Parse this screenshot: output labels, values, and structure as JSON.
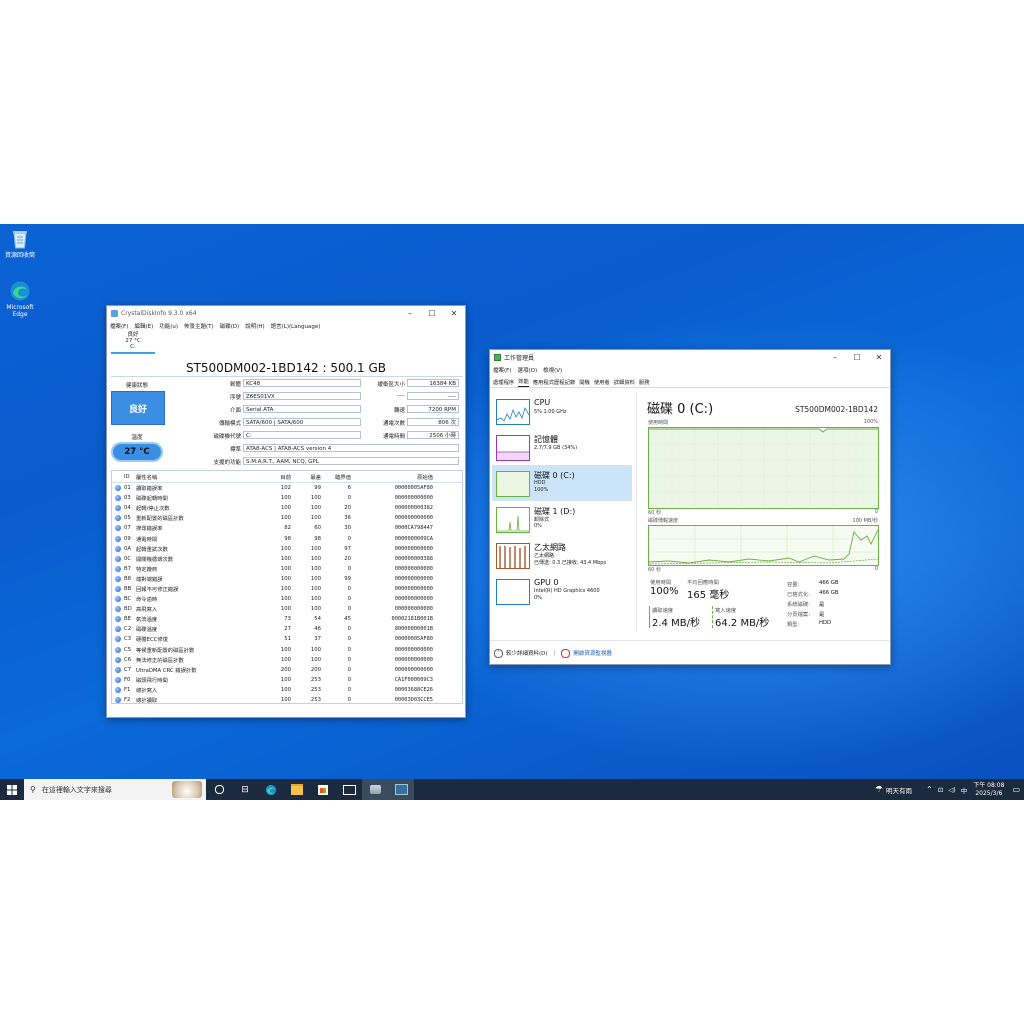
{
  "desktop": {
    "icons": [
      {
        "label": "資源回收筒"
      },
      {
        "label": "Microsoft Edge"
      }
    ]
  },
  "cdi": {
    "title": "CrystalDiskInfo 9.3.0 x64",
    "menu": [
      "檔案(F)",
      "編輯(E)",
      "功能(u)",
      "佈景主題(T)",
      "磁碟(D)",
      "說明(H)",
      "語言(L)(Language)"
    ],
    "status_tab": {
      "health": "良好",
      "temp": "27 °C",
      "drive": "C:"
    },
    "model": "ST500DM002-1BD142 : 500.1 GB",
    "health_label": "健康狀態",
    "health_value": "良好",
    "temp_label": "溫度",
    "temp_value": "27 °C",
    "fields": {
      "firmware": {
        "label": "韌體",
        "value": "KC48"
      },
      "serial": {
        "label": "序號",
        "value": "Z6ES01VX"
      },
      "interface": {
        "label": "介面",
        "value": "Serial ATA"
      },
      "transfer": {
        "label": "傳輸模式",
        "value": "SATA/600 | SATA/600"
      },
      "drive_letter": {
        "label": "磁碟機代號",
        "value": "C:"
      },
      "standard": {
        "label": "標準",
        "value": "ATA8-ACS | ATA8-ACS version 4"
      },
      "features": {
        "label": "支援的功能",
        "value": "S.M.A.R.T., AAM, NCQ, GPL"
      },
      "buffer": {
        "label": "緩衝區大小",
        "value": "16384 KB"
      },
      "blank1": {
        "label": "----",
        "value": "----"
      },
      "rpm": {
        "label": "轉速",
        "value": "7200 RPM"
      },
      "power_count": {
        "label": "通電次數",
        "value": "806 次"
      },
      "power_hours": {
        "label": "通電時間",
        "value": "2506 小時"
      }
    },
    "table_headers": [
      "ID",
      "屬性名稱",
      "目前",
      "最差",
      "臨界值",
      "原始值"
    ],
    "rows": [
      {
        "id": "01",
        "name": "讀取錯誤率",
        "cur": "102",
        "wst": "99",
        "thr": "6",
        "raw": "00000005AF80"
      },
      {
        "id": "03",
        "name": "磁碟起轉時間",
        "cur": "100",
        "wst": "100",
        "thr": "0",
        "raw": "000000000000"
      },
      {
        "id": "04",
        "name": "起轉/停止次數",
        "cur": "100",
        "wst": "100",
        "thr": "20",
        "raw": "000000000382"
      },
      {
        "id": "05",
        "name": "重新配置的磁區計數",
        "cur": "100",
        "wst": "100",
        "thr": "36",
        "raw": "000000000000"
      },
      {
        "id": "07",
        "name": "搜尋錯誤率",
        "cur": "82",
        "wst": "60",
        "thr": "30",
        "raw": "0000CA798447"
      },
      {
        "id": "09",
        "name": "通電時間",
        "cur": "98",
        "wst": "98",
        "thr": "0",
        "raw": "0000000009CA"
      },
      {
        "id": "0A",
        "name": "起轉重試次數",
        "cur": "100",
        "wst": "100",
        "thr": "97",
        "raw": "000000000000"
      },
      {
        "id": "0C",
        "name": "開關機循環次數",
        "cur": "100",
        "wst": "100",
        "thr": "20",
        "raw": "000000000388"
      },
      {
        "id": "B7",
        "name": "特定廠商",
        "cur": "100",
        "wst": "100",
        "thr": "0",
        "raw": "000000000000"
      },
      {
        "id": "B8",
        "name": "端對端錯誤",
        "cur": "100",
        "wst": "100",
        "thr": "99",
        "raw": "000000000000"
      },
      {
        "id": "BB",
        "name": "回報不可修正錯誤",
        "cur": "100",
        "wst": "100",
        "thr": "0",
        "raw": "000000000000"
      },
      {
        "id": "BC",
        "name": "命令逾時",
        "cur": "100",
        "wst": "100",
        "thr": "0",
        "raw": "000000000000"
      },
      {
        "id": "BD",
        "name": "高飛寫入",
        "cur": "100",
        "wst": "100",
        "thr": "0",
        "raw": "000000000000"
      },
      {
        "id": "BE",
        "name": "氣流溫度",
        "cur": "73",
        "wst": "54",
        "thr": "45",
        "raw": "00002181B001B"
      },
      {
        "id": "C2",
        "name": "磁碟溫度",
        "cur": "27",
        "wst": "46",
        "thr": "0",
        "raw": "80000000001B"
      },
      {
        "id": "C3",
        "name": "硬體ECC修復",
        "cur": "51",
        "wst": "37",
        "thr": "0",
        "raw": "00000005AF80"
      },
      {
        "id": "C5",
        "name": "等候重新配置的磁區計數",
        "cur": "100",
        "wst": "100",
        "thr": "0",
        "raw": "000000000000"
      },
      {
        "id": "C6",
        "name": "無法修正的磁區計數",
        "cur": "100",
        "wst": "100",
        "thr": "0",
        "raw": "000000000000"
      },
      {
        "id": "C7",
        "name": "UltraDMA CRC 錯誤計數",
        "cur": "200",
        "wst": "200",
        "thr": "0",
        "raw": "000000000000"
      },
      {
        "id": "F0",
        "name": "磁頭飛行時間",
        "cur": "100",
        "wst": "253",
        "thr": "0",
        "raw": "CA1F000009C3"
      },
      {
        "id": "F1",
        "name": "總計寫入",
        "cur": "100",
        "wst": "253",
        "thr": "0",
        "raw": "00003688CE26"
      },
      {
        "id": "F2",
        "name": "總計讀取",
        "cur": "100",
        "wst": "253",
        "thr": "0",
        "raw": "00003D03CCE5"
      }
    ]
  },
  "tm": {
    "title": "工作管理員",
    "menu": [
      "檔案(F)",
      "選項(O)",
      "檢視(V)"
    ],
    "tabs": [
      "處理程序",
      "效能",
      "應用程式歷程記錄",
      "開機",
      "使用者",
      "詳細資料",
      "服務"
    ],
    "perf_list": [
      {
        "name": "CPU",
        "sub1": "5% 1.00 GHz",
        "sub2": ""
      },
      {
        "name": "記憶體",
        "sub1": "2.7/7.9 GB (34%)",
        "sub2": ""
      },
      {
        "name": "磁碟 0 (C:)",
        "sub1": "HDD",
        "sub2": "100%"
      },
      {
        "name": "磁碟 1 (D:)",
        "sub1": "卸除式",
        "sub2": "0%"
      },
      {
        "name": "乙太網路",
        "sub1": "乙太網路",
        "sub2": "已傳送: 0.3 已接收: 43.4 Mbps"
      },
      {
        "name": "GPU 0",
        "sub1": "Intel(R) HD Graphics 4600",
        "sub2": "0%"
      }
    ],
    "disk_title": "磁碟 0 (C:)",
    "disk_model": "ST500DM002-1BD142",
    "graph1_label": "使用時間",
    "graph1_max": "100%",
    "graph1_left": "60 秒",
    "graph1_right": "0",
    "graph2_label": "磁碟傳輸速度",
    "graph2_max": "100 MB/秒",
    "graph2_left": "60 秒",
    "graph2_right": "0",
    "stats": {
      "active_label": "使用時間",
      "active_value": "100%",
      "resp_label": "平均回應時間",
      "resp_value": "165 毫秒",
      "read_label": "讀取速度",
      "read_value": "2.4 MB/秒",
      "write_label": "寫入速度",
      "write_value": "64.2 MB/秒"
    },
    "kv": [
      {
        "k": "容量:",
        "v": "466 GB"
      },
      {
        "k": "已格式化:",
        "v": "466 GB"
      },
      {
        "k": "系統磁碟:",
        "v": "是"
      },
      {
        "k": "分頁檔案:",
        "v": "是"
      },
      {
        "k": "類型:",
        "v": "HDD"
      }
    ],
    "footer_less": "較少詳細資料(D)",
    "footer_monitor": "開啟資源監視器"
  },
  "taskbar": {
    "search_placeholder": "在這裡輸入文字來搜尋",
    "weather": "明天有雨",
    "ime": "中",
    "time": "下午 08:08",
    "date": "2025/3/6"
  },
  "colors": {
    "desktop_blue": "#0a5ccc",
    "health_blue": "#3a8fe5",
    "disk_green": "#6bb043",
    "selected": "#cce4f7",
    "taskbar": "#1b2a3e"
  }
}
